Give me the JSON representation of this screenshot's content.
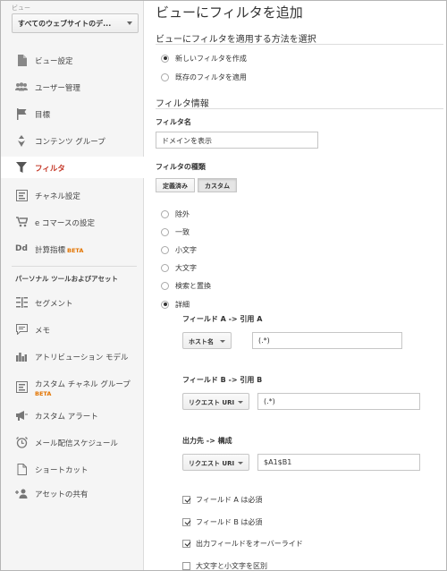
{
  "sidebar": {
    "view_label": "ビュー",
    "view_select": "すべてのウェブサイトのデ...",
    "items": [
      {
        "label": "ビュー設定"
      },
      {
        "label": "ユーザー管理"
      },
      {
        "label": "目標"
      },
      {
        "label": "コンテンツ グループ"
      },
      {
        "label": "フィルタ"
      },
      {
        "label": "チャネル設定"
      },
      {
        "label": "e コマースの設定"
      },
      {
        "label": "計算指標",
        "badge": "BETA"
      }
    ],
    "section_heading": "パーソナル ツールおよびアセット",
    "tools": [
      {
        "label": "セグメント"
      },
      {
        "label": "メモ"
      },
      {
        "label": "アトリビューション モデル"
      },
      {
        "label": "カスタム チャネル グループ",
        "badge": "BETA"
      },
      {
        "label": "カスタム アラート"
      },
      {
        "label": "メール配信スケジュール"
      },
      {
        "label": "ショートカット"
      },
      {
        "label": "アセットの共有"
      }
    ]
  },
  "main": {
    "title": "ビューにフィルタを追加",
    "method_heading": "ビューにフィルタを適用する方法を選択",
    "method_options": [
      "新しいフィルタを作成",
      "既存のフィルタを適用"
    ],
    "info_heading": "フィルタ情報",
    "name_label": "フィルタ名",
    "name_value": "ドメインを表示",
    "type_label": "フィルタの種類",
    "type_tabs": [
      "定義済み",
      "カスタム"
    ],
    "custom_options": [
      "除外",
      "一致",
      "小文字",
      "大文字",
      "検索と置換",
      "詳細"
    ],
    "field_a": {
      "label": "フィールド A -> 引用 A",
      "select": "ホスト名",
      "value": "(.*)"
    },
    "field_b": {
      "label": "フィールド B -> 引用 B",
      "select": "リクエスト URI",
      "value": "(.*)"
    },
    "output": {
      "label": "出力先 -> 構成",
      "select": "リクエスト URI",
      "value": "$A1$B1"
    },
    "checkboxes": [
      {
        "label": "フィールド A は必須",
        "checked": true
      },
      {
        "label": "フィールド B は必須",
        "checked": true
      },
      {
        "label": "出力フィールドをオーバーライド",
        "checked": true
      },
      {
        "label": "大文字と小文字を区別",
        "checked": false
      }
    ]
  }
}
